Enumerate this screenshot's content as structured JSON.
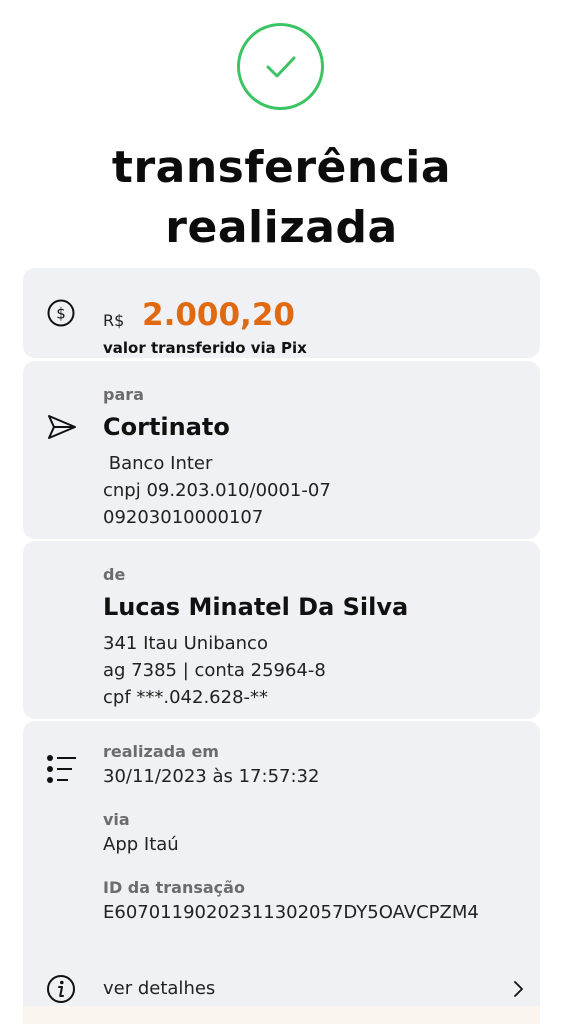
{
  "header": {
    "title_line1": "transferência",
    "title_line2": "realizada",
    "status_icon": "check-circle-icon",
    "status_color": "#3cc464"
  },
  "amount": {
    "icon": "dollar-circle-icon",
    "currency": "R$",
    "value": "2.000,20",
    "value_color": "#e06a12",
    "subtitle": "valor transferido via Pix"
  },
  "recipient": {
    "icon": "send-icon",
    "label": "para",
    "name": "Cortinato",
    "bank": " Banco Inter",
    "document": "cnpj 09.203.010/0001-07",
    "key": "09203010000107"
  },
  "sender": {
    "label": "de",
    "name": "Lucas Minatel Da Silva",
    "bank": "341 Itau Unibanco",
    "account": "ag 7385 | conta 25964-8",
    "document": "cpf ***.042.628-**"
  },
  "info": {
    "icon": "list-icon",
    "date_label": "realizada em",
    "date_value": "30/11/2023 às 17:57:32",
    "via_label": "via",
    "via_value": "App Itaú",
    "id_label": "ID da transação",
    "id_value": "E60701190202311302057DY5OAVCPZM4"
  },
  "details": {
    "icon": "info-icon",
    "label": "ver detalhes",
    "chevron": "chevron-right-icon"
  }
}
